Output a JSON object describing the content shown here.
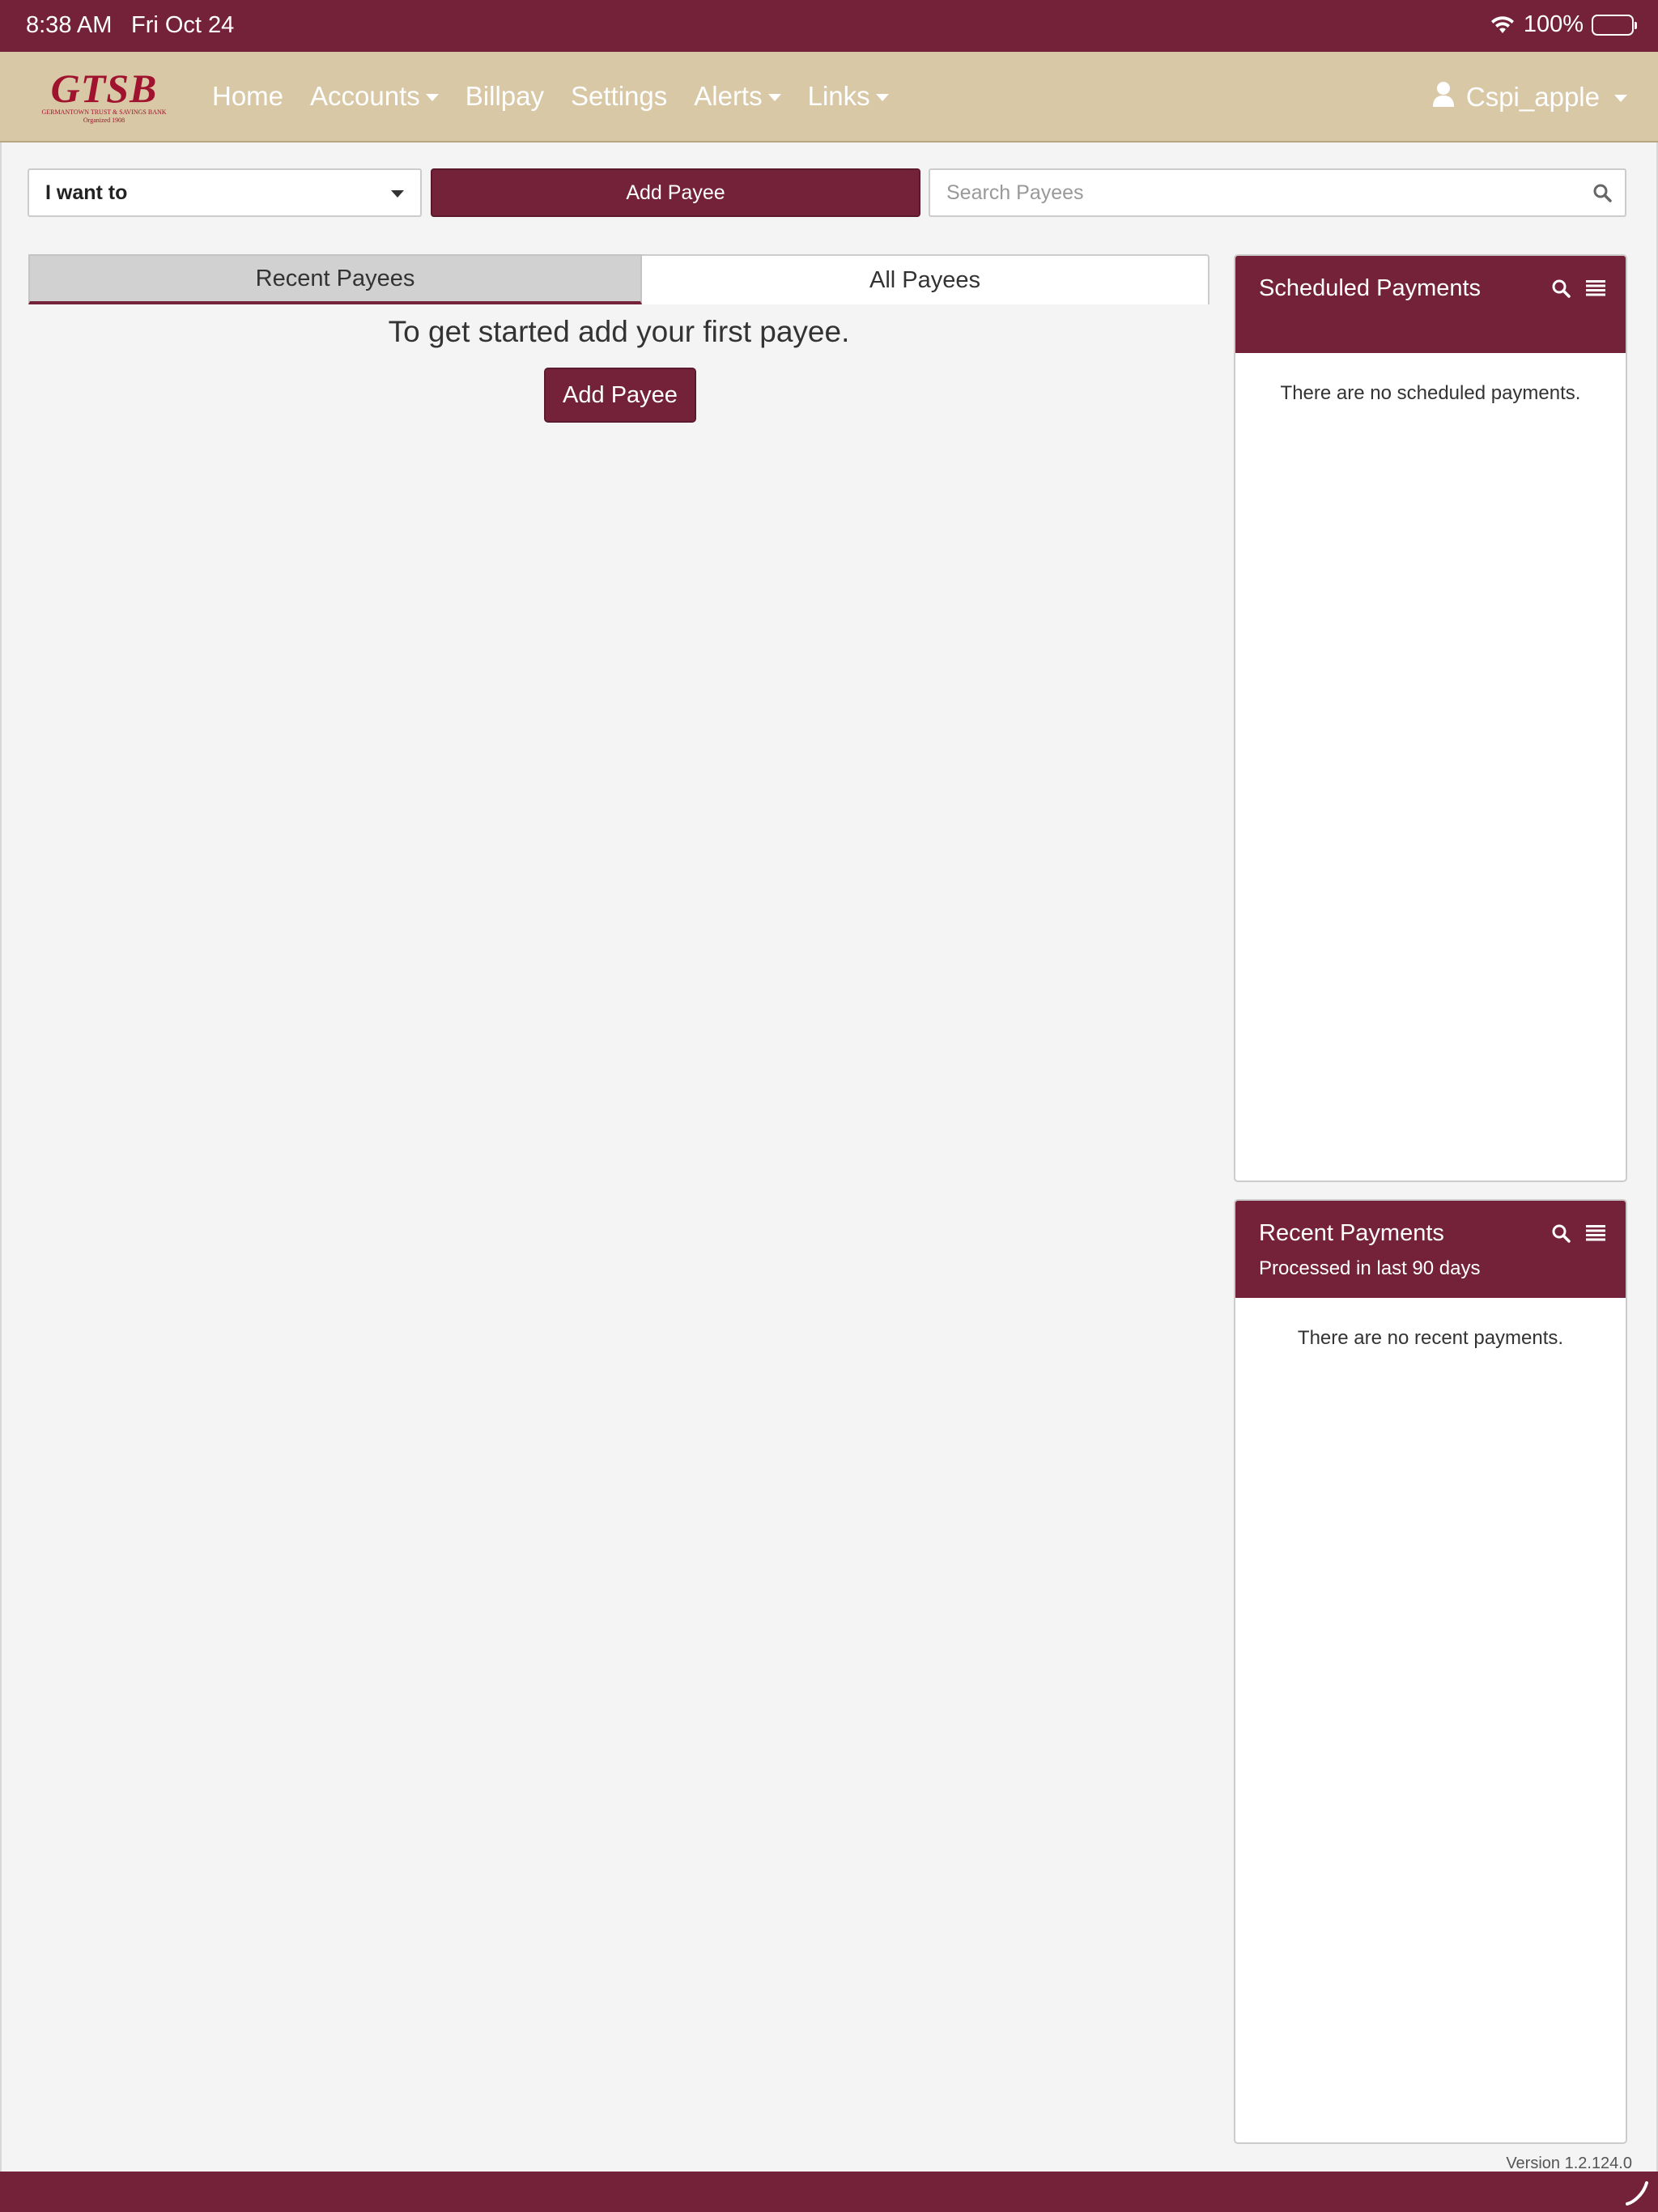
{
  "status_bar": {
    "time": "8:38 AM",
    "date": "Fri Oct 24",
    "battery": "100%"
  },
  "navbar": {
    "logo_text": "GTSB",
    "logo_subtext": "GERMANTOWN TRUST & SAVINGS BANK",
    "logo_tagline": "Organized 1908",
    "items": [
      {
        "label": "Home",
        "dropdown": false
      },
      {
        "label": "Accounts",
        "dropdown": true
      },
      {
        "label": "Billpay",
        "dropdown": false
      },
      {
        "label": "Settings",
        "dropdown": false
      },
      {
        "label": "Alerts",
        "dropdown": true
      },
      {
        "label": "Links",
        "dropdown": true
      }
    ],
    "user": "Cspi_apple"
  },
  "toolbar": {
    "action_select": "I want to",
    "add_payee_label": "Add Payee",
    "search_placeholder": "Search Payees"
  },
  "tabs": [
    {
      "label": "Recent Payees",
      "active": true
    },
    {
      "label": "All Payees",
      "active": false
    }
  ],
  "main": {
    "empty_message": "To get started add your first payee.",
    "add_payee_label": "Add Payee"
  },
  "scheduled_payments": {
    "title": "Scheduled Payments",
    "empty_message": "There are no scheduled payments."
  },
  "recent_payments": {
    "title": "Recent Payments",
    "subtitle": "Processed in last 90 days",
    "empty_message": "There are no recent payments."
  },
  "footer": {
    "version": "Version 1.2.124.0"
  },
  "colors": {
    "brand": "#74223a",
    "nav_background": "#d8c8a6",
    "page_background": "#f4f4f4"
  }
}
